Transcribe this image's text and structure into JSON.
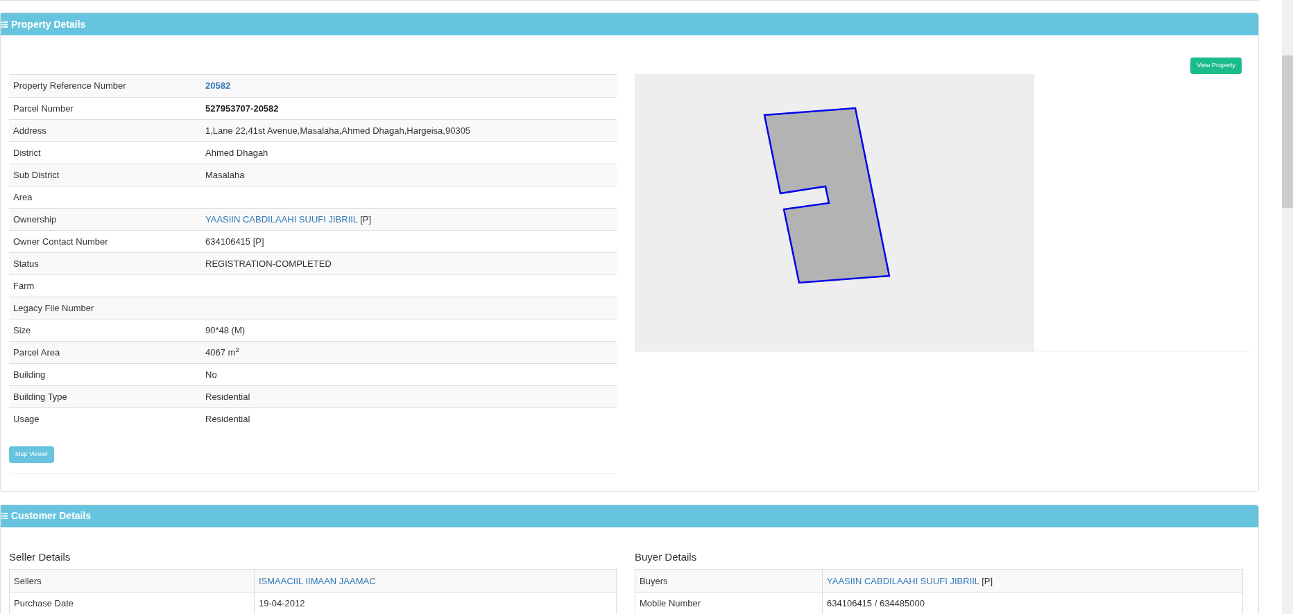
{
  "property_panel": {
    "title": "Property Details",
    "view_button": "View Property",
    "map_button": "Map Viewer",
    "rows": [
      {
        "label": "Property Reference Number",
        "value": "20582",
        "kind": "link-bold"
      },
      {
        "label": "Parcel Number",
        "value": "527953707-20582",
        "kind": "bold"
      },
      {
        "label": "Address",
        "value": "1,Lane 22,41st Avenue,Masalaha,Ahmed Dhagah,Hargeisa,90305",
        "kind": "plain"
      },
      {
        "label": "District",
        "value": "Ahmed Dhagah",
        "kind": "plain"
      },
      {
        "label": "Sub District",
        "value": "Masalaha",
        "kind": "plain"
      },
      {
        "label": "Area",
        "kind": "plain"
      },
      {
        "label": "Ownership",
        "value": "YAASIIN CABDILAAHI SUUFI JIBRIIL",
        "note": "[P]",
        "kind": "link"
      },
      {
        "label": "Owner Contact Number",
        "value": "634106415 [P]",
        "kind": "plain"
      },
      {
        "label": "Status",
        "value": "REGISTRATION-COMPLETED",
        "kind": "plain"
      },
      {
        "label": "Farm",
        "kind": "plain"
      },
      {
        "label": "Legacy File Number",
        "kind": "plain"
      },
      {
        "label": "Size",
        "value": "90*48 (M)",
        "kind": "plain"
      },
      {
        "label": "Parcel Area",
        "value": "4067 m$^{2}$",
        "kind": "plain"
      },
      {
        "label": "Building",
        "value": "No",
        "kind": "plain"
      },
      {
        "label": "Building Type",
        "value": "Residential",
        "kind": "plain"
      },
      {
        "label": "Usage",
        "value": "Residential",
        "kind": "plain"
      }
    ]
  },
  "customer_panel": {
    "title": "Customer Details",
    "seller": {
      "heading": "Seller Details",
      "rows": [
        {
          "label": "Sellers",
          "value": "ISMAACIIL IIMAAN JAAMAC",
          "kind": "link"
        },
        {
          "label": "Purchase Date",
          "value": "19-04-2012",
          "kind": "plain"
        }
      ]
    },
    "buyer": {
      "heading": "Buyer Details",
      "rows": [
        {
          "label": "Buyers",
          "value": "YAASIIN CABDILAAHI SUUFI JIBRIIL",
          "note": "[P]",
          "kind": "link"
        },
        {
          "label": "Mobile Number",
          "value": "634106415 / 634485000",
          "kind": "plain"
        }
      ]
    }
  }
}
